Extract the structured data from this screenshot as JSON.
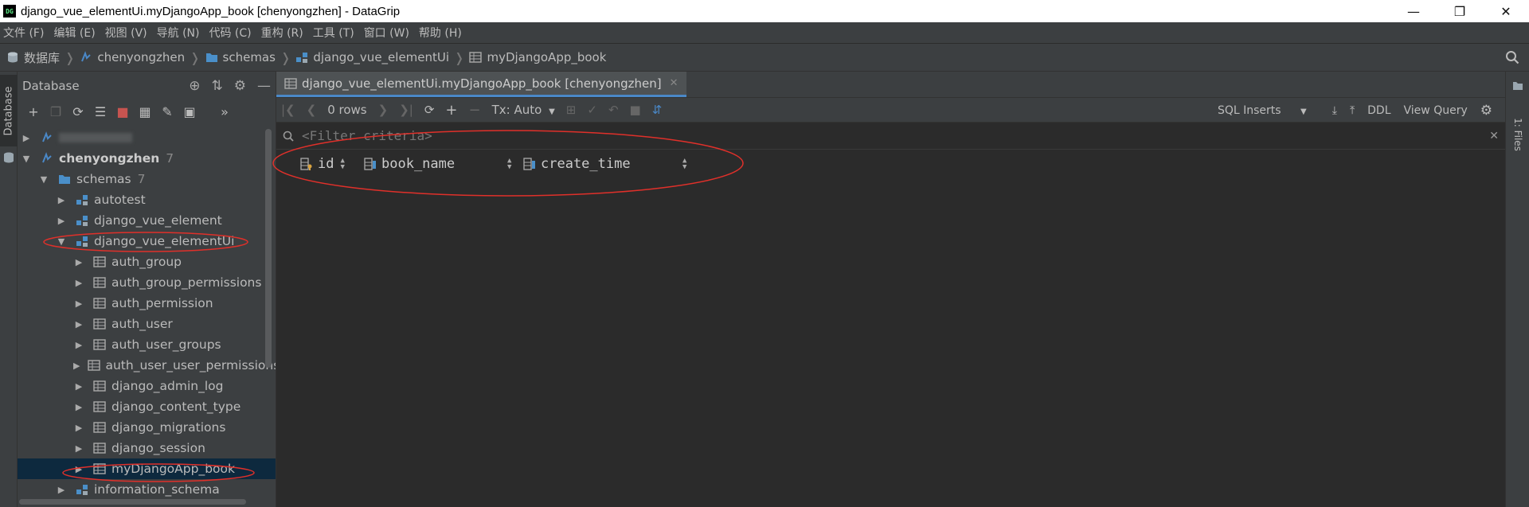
{
  "window": {
    "title": "django_vue_elementUi.myDjangoApp_book [chenyongzhen] - DataGrip",
    "app_icon_text": "DG"
  },
  "menu": [
    "文件 (F)",
    "编辑 (E)",
    "视图 (V)",
    "导航 (N)",
    "代码 (C)",
    "重构 (R)",
    "工具 (T)",
    "窗口 (W)",
    "帮助 (H)"
  ],
  "breadcrumb": [
    "数据库",
    "chenyongzhen",
    "schemas",
    "django_vue_elementUi",
    "myDjangoApp_book"
  ],
  "left_strip": {
    "tab_label": "Database"
  },
  "right_strip": {
    "tab_label": "1: Files"
  },
  "db_panel": {
    "title": "Database",
    "tree": [
      {
        "label": "",
        "level": 0,
        "expanded": false,
        "type": "datasource",
        "blurred": true
      },
      {
        "label": "chenyongzhen",
        "count": "7",
        "level": 0,
        "expanded": true,
        "type": "datasource"
      },
      {
        "label": "schemas",
        "count": "7",
        "level": 1,
        "expanded": true,
        "type": "folder"
      },
      {
        "label": "autotest",
        "level": 2,
        "expanded": false,
        "type": "schema"
      },
      {
        "label": "django_vue_element",
        "level": 2,
        "expanded": false,
        "type": "schema"
      },
      {
        "label": "django_vue_elementUi",
        "level": 2,
        "expanded": true,
        "type": "schema"
      },
      {
        "label": "auth_group",
        "level": 3,
        "expanded": false,
        "type": "table"
      },
      {
        "label": "auth_group_permissions",
        "level": 3,
        "expanded": false,
        "type": "table"
      },
      {
        "label": "auth_permission",
        "level": 3,
        "expanded": false,
        "type": "table"
      },
      {
        "label": "auth_user",
        "level": 3,
        "expanded": false,
        "type": "table"
      },
      {
        "label": "auth_user_groups",
        "level": 3,
        "expanded": false,
        "type": "table"
      },
      {
        "label": "auth_user_user_permissions",
        "level": 3,
        "expanded": false,
        "type": "table"
      },
      {
        "label": "django_admin_log",
        "level": 3,
        "expanded": false,
        "type": "table"
      },
      {
        "label": "django_content_type",
        "level": 3,
        "expanded": false,
        "type": "table"
      },
      {
        "label": "django_migrations",
        "level": 3,
        "expanded": false,
        "type": "table"
      },
      {
        "label": "django_session",
        "level": 3,
        "expanded": false,
        "type": "table"
      },
      {
        "label": "myDjangoApp_book",
        "level": 3,
        "expanded": false,
        "type": "table",
        "selected": true
      },
      {
        "label": "information_schema",
        "level": 2,
        "expanded": false,
        "type": "schema"
      }
    ]
  },
  "editor": {
    "tab_label": "django_vue_elementUi.myDjangoApp_book [chenyongzhen]",
    "rows_label": "0 rows",
    "tx_label": "Tx: Auto",
    "sql_inserts_label": "SQL Inserts",
    "ddl_label": "DDL",
    "view_query_label": "View Query",
    "filter_placeholder": "<Filter criteria>",
    "columns": [
      "id",
      "book_name",
      "create_time"
    ]
  },
  "colors": {
    "accent": "#4a88c7",
    "annotation": "#e0302a",
    "selection": "#0d293e"
  }
}
